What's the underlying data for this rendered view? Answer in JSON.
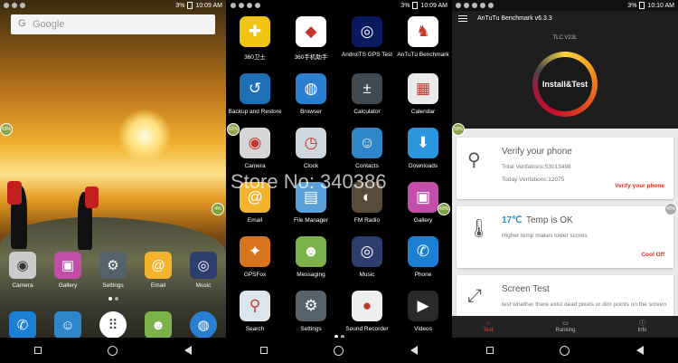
{
  "status": {
    "battery_p1": "3%",
    "time_p1": "10:09 AM",
    "battery_p2": "3%",
    "time_p2": "10:09 AM",
    "battery_p3": "3%",
    "time_p3": "10:10 AM"
  },
  "home": {
    "search_placeholder": "Google",
    "badge_left": "53%",
    "badge_right": "4%",
    "dock": [
      {
        "label": "Camera",
        "icon": "camera-icon"
      },
      {
        "label": "Gallery",
        "icon": "gallery-icon"
      },
      {
        "label": "Settings",
        "icon": "settings-icon"
      },
      {
        "label": "Email",
        "icon": "email-icon"
      },
      {
        "label": "Music",
        "icon": "music-icon"
      }
    ],
    "hotseat": [
      "phone-icon",
      "contacts-icon",
      "app-drawer-icon",
      "messaging-icon",
      "browser-icon"
    ]
  },
  "drawer": {
    "badge_left": "52%",
    "badge_right": "49%",
    "apps": [
      {
        "label": "360卫士",
        "icon": "360-security-icon",
        "color": "#f1c40f",
        "glyph": "✚"
      },
      {
        "label": "360手机助手",
        "icon": "360-assistant-icon",
        "color": "#ffffff",
        "glyph": "◆"
      },
      {
        "label": "AndroiTS GPS Test",
        "icon": "gps-test-icon",
        "color": "#0a1a60",
        "glyph": "◎"
      },
      {
        "label": "AnTuTu Benchmark",
        "icon": "antutu-icon",
        "color": "#ffffff",
        "glyph": "♞"
      },
      {
        "label": "Backup and Restore",
        "icon": "backup-icon",
        "color": "#1f6fb5",
        "glyph": "↺"
      },
      {
        "label": "Browser",
        "icon": "browser-icon",
        "color": "#2a7fd0",
        "glyph": "◍"
      },
      {
        "label": "Calculator",
        "icon": "calculator-icon",
        "color": "#3e4a4f",
        "glyph": "±"
      },
      {
        "label": "Calendar",
        "icon": "calendar-icon",
        "color": "#eaeaea",
        "glyph": "▦"
      },
      {
        "label": "Camera",
        "icon": "camera-icon",
        "color": "#d5d5d5",
        "glyph": "◉"
      },
      {
        "label": "Clock",
        "icon": "clock-icon",
        "color": "#cfd6de",
        "glyph": "◷"
      },
      {
        "label": "Contacts",
        "icon": "contacts-icon",
        "color": "#2f86c8",
        "glyph": "☺"
      },
      {
        "label": "Downloads",
        "icon": "downloads-icon",
        "color": "#2b95dd",
        "glyph": "⬇"
      },
      {
        "label": "Email",
        "icon": "email-icon",
        "color": "#f3b32d",
        "glyph": "@"
      },
      {
        "label": "File Manager",
        "icon": "file-manager-icon",
        "color": "#5aa0d8",
        "glyph": "▤"
      },
      {
        "label": "FM Radio",
        "icon": "fm-radio-icon",
        "color": "#5a4a3a",
        "glyph": "◐"
      },
      {
        "label": "Gallery",
        "icon": "gallery-icon",
        "color": "#c34ea8",
        "glyph": "▣"
      },
      {
        "label": "GPSFox",
        "icon": "gpsfox-icon",
        "color": "#d8731e",
        "glyph": "✦"
      },
      {
        "label": "Messaging",
        "icon": "messaging-icon",
        "color": "#7bb34a",
        "glyph": "☻"
      },
      {
        "label": "Music",
        "icon": "music-icon",
        "color": "#2d3d6d",
        "glyph": "◎"
      },
      {
        "label": "Phone",
        "icon": "phone-icon",
        "color": "#1b7fd4",
        "glyph": "✆"
      },
      {
        "label": "Search",
        "icon": "search-icon",
        "color": "#dce4ec",
        "glyph": "⚲"
      },
      {
        "label": "Settings",
        "icon": "settings-icon",
        "color": "#55626b",
        "glyph": "⚙"
      },
      {
        "label": "Sound Recorder",
        "icon": "sound-recorder-icon",
        "color": "#eeeeee",
        "glyph": "●"
      },
      {
        "label": "Videos",
        "icon": "videos-icon",
        "color": "#2a2a2a",
        "glyph": "▶"
      }
    ]
  },
  "watermark": "Store No: 340386",
  "antutu": {
    "title": "AnTuTu Benchmark v6.3.3",
    "device": "TLC V23L",
    "install_button": "Install&Test",
    "badge_left": "58%",
    "badge_right": "45%",
    "verify": {
      "title": "Verify your phone",
      "total": "Total Verifations:53013498",
      "today": "Today Verifations:12075",
      "link": "Verify your phone"
    },
    "temp": {
      "value": "17℃",
      "title": "Temp is OK",
      "desc": "Higher temp makes lower scores",
      "link": "Cool Off"
    },
    "screen": {
      "title": "Screen Test",
      "desc": "test whether there exist dead pixels or dim points on the screen"
    },
    "tabs": [
      "Test",
      "Ranking",
      "Info"
    ]
  }
}
